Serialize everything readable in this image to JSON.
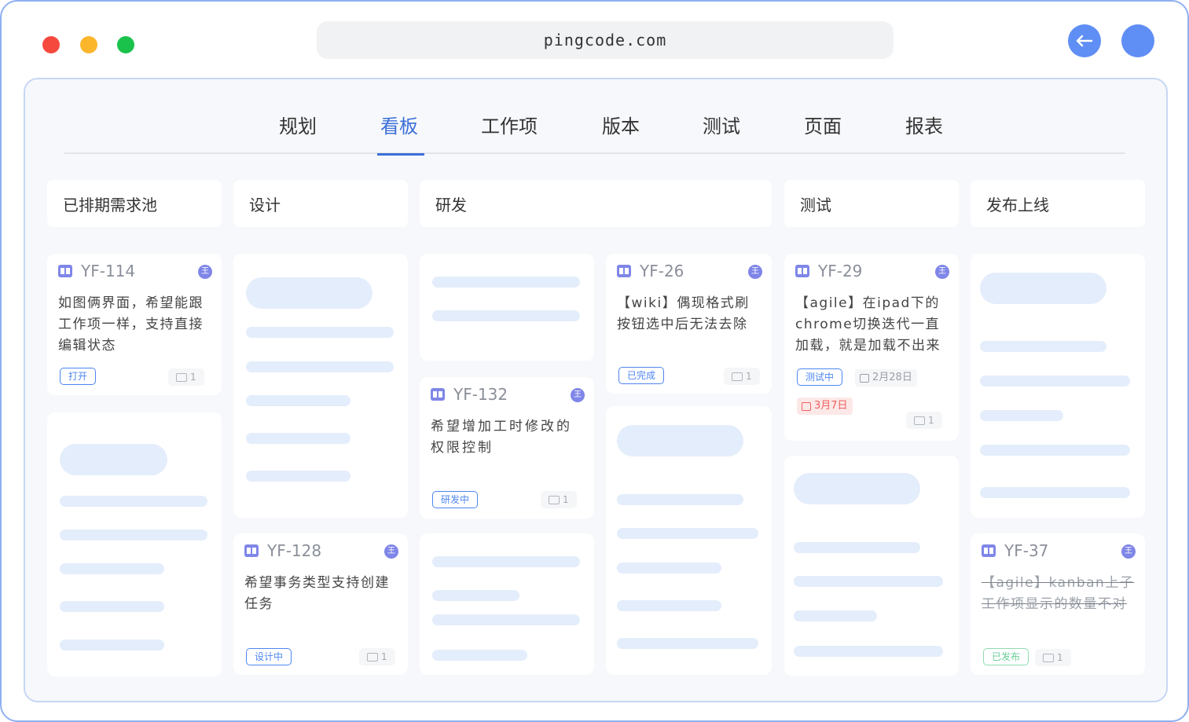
{
  "browser": {
    "url": "pingcode.com",
    "back_icon": "arrow-left-icon",
    "user_icon": "avatar-icon"
  },
  "tabs": [
    "规划",
    "看板",
    "工作项",
    "版本",
    "测试",
    "页面",
    "报表"
  ],
  "active_tab": "看板",
  "columns": [
    "已排期需求池",
    "设计",
    "研发",
    "测试",
    "发布上线"
  ],
  "cards": {
    "yf114": {
      "id": "YF-114",
      "title_lines": [
        "如图俩界面，希望能跟",
        "工作项一样，支持直接",
        "编辑状态"
      ],
      "status": "打开",
      "comments": "1",
      "assignee": "王"
    },
    "yf128": {
      "id": "YF-128",
      "title_lines": [
        "希望事务类型支持创建",
        "任务"
      ],
      "status": "设计中",
      "comments": "1",
      "assignee": "王"
    },
    "yf132": {
      "id": "YF-132",
      "title_lines": [
        "希望增加工时修改的",
        "权限控制"
      ],
      "status": "研发中",
      "comments": "1",
      "assignee": "王"
    },
    "yf26": {
      "id": "YF-26",
      "title_lines": [
        "【wiki】偶现格式刷",
        "按钮选中后无法去除"
      ],
      "status": "已完成",
      "comments": "1",
      "assignee": "王"
    },
    "yf29": {
      "id": "YF-29",
      "title_lines": [
        "【agile】在ipad下的",
        "chrome切换迭代一直",
        "加载，就是加载不出来"
      ],
      "status": "测试中",
      "start_date": "2月28日",
      "due_date": "3月7日",
      "comments": "1",
      "assignee": "王"
    },
    "yf37": {
      "id": "YF-37",
      "title_lines": [
        "【agile】kanban上子",
        "工作项显示的数量不对"
      ],
      "status": "已发布",
      "comments": "1",
      "assignee": "王"
    }
  },
  "colors": {
    "accent": "#3b6fd9",
    "skeleton": "#e4edfb",
    "status_blue": "#4d86f0",
    "status_green": "#6bcf99",
    "overdue": "#f06060"
  }
}
